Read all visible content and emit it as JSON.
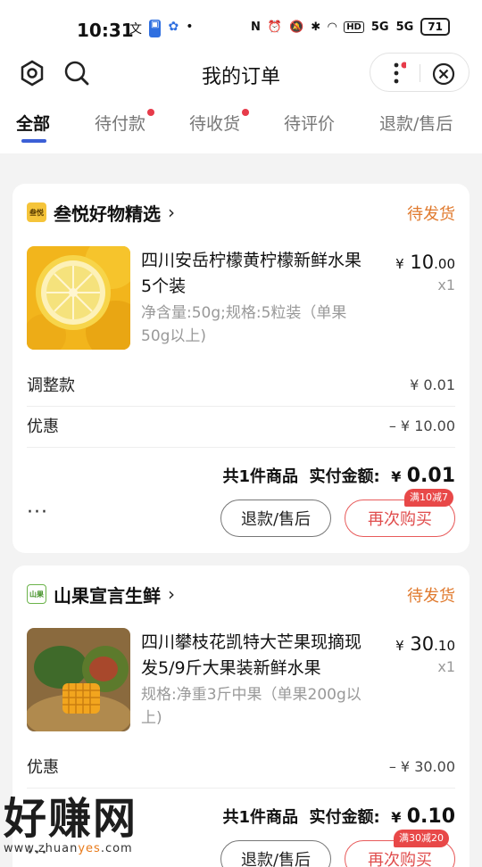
{
  "status_bar": {
    "time": "10:31",
    "network_icons": [
      "5G",
      "5G"
    ],
    "hd_label": "HD",
    "battery": "71"
  },
  "header": {
    "title": "我的订单"
  },
  "tabs": [
    {
      "label": "全部",
      "active": true,
      "dot": false
    },
    {
      "label": "待付款",
      "active": false,
      "dot": true
    },
    {
      "label": "待收货",
      "active": false,
      "dot": true
    },
    {
      "label": "待评价",
      "active": false,
      "dot": false
    },
    {
      "label": "退款/售后",
      "active": false,
      "dot": false
    }
  ],
  "orders": [
    {
      "shop": {
        "name": "叁悦好物精选",
        "logo_text": "叁悦"
      },
      "status": "待发货",
      "product": {
        "title": "四川安岳柠檬黄柠檬新鲜水果5个装",
        "spec": "净含量:50g;规格:5粒装（单果50g以上)",
        "price_prefix": "¥",
        "price_int": "10",
        "price_dec": ".00",
        "qty": "x1"
      },
      "lines": [
        {
          "label": "调整款",
          "value": "¥ 0.01"
        },
        {
          "label": "优惠",
          "value": "– ¥ 10.00"
        }
      ],
      "summary": {
        "count_label": "共1件商品",
        "paid_label": "实付金额:",
        "currency": "¥",
        "amount": "0.01"
      },
      "more": "···",
      "buttons": {
        "refund": "退款/售后",
        "rebuy": "再次购买",
        "promo": "满10减7"
      }
    },
    {
      "shop": {
        "name": "山果宣言生鲜",
        "logo_text": "山果"
      },
      "status": "待发货",
      "product": {
        "title": "四川攀枝花凯特大芒果现摘现发5/9斤大果装新鲜水果",
        "spec": "规格:净重3斤中果（单果200g以上)",
        "price_prefix": "¥",
        "price_int": "30",
        "price_dec": ".10",
        "qty": "x1"
      },
      "lines": [
        {
          "label": "优惠",
          "value": "– ¥ 30.00"
        }
      ],
      "summary": {
        "count_label": "共1件商品",
        "paid_label": "实付金额:",
        "currency": "¥",
        "amount": "0.10"
      },
      "more": "···",
      "buttons": {
        "refund": "退款/售后",
        "rebuy": "再次购买",
        "promo": "满30减20"
      }
    }
  ],
  "watermark": {
    "big": "好赚网",
    "small_a": "www.zhuan",
    "small_b": "yes",
    "small_c": ".com"
  },
  "colors": {
    "accent": "#3c5fd6",
    "status_orange": "#e07a2e",
    "rebuy_red": "#e04d4d",
    "dot_red": "#e73b4a"
  }
}
